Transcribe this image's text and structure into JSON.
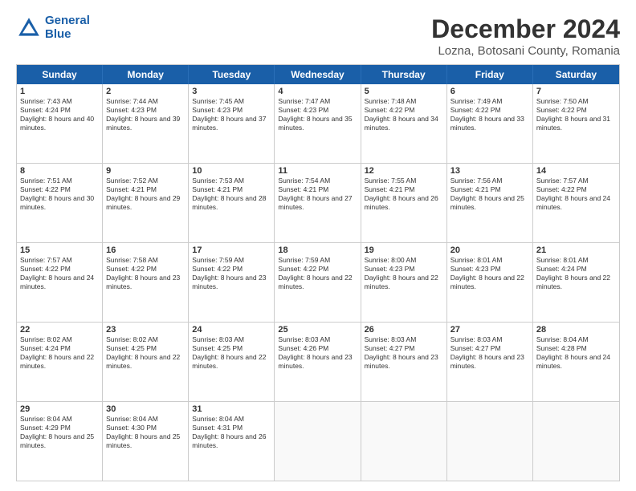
{
  "logo": {
    "line1": "General",
    "line2": "Blue"
  },
  "title": "December 2024",
  "subtitle": "Lozna, Botosani County, Romania",
  "header_days": [
    "Sunday",
    "Monday",
    "Tuesday",
    "Wednesday",
    "Thursday",
    "Friday",
    "Saturday"
  ],
  "weeks": [
    [
      {
        "day": "1",
        "sunrise": "Sunrise: 7:43 AM",
        "sunset": "Sunset: 4:24 PM",
        "daylight": "Daylight: 8 hours and 40 minutes."
      },
      {
        "day": "2",
        "sunrise": "Sunrise: 7:44 AM",
        "sunset": "Sunset: 4:23 PM",
        "daylight": "Daylight: 8 hours and 39 minutes."
      },
      {
        "day": "3",
        "sunrise": "Sunrise: 7:45 AM",
        "sunset": "Sunset: 4:23 PM",
        "daylight": "Daylight: 8 hours and 37 minutes."
      },
      {
        "day": "4",
        "sunrise": "Sunrise: 7:47 AM",
        "sunset": "Sunset: 4:23 PM",
        "daylight": "Daylight: 8 hours and 35 minutes."
      },
      {
        "day": "5",
        "sunrise": "Sunrise: 7:48 AM",
        "sunset": "Sunset: 4:22 PM",
        "daylight": "Daylight: 8 hours and 34 minutes."
      },
      {
        "day": "6",
        "sunrise": "Sunrise: 7:49 AM",
        "sunset": "Sunset: 4:22 PM",
        "daylight": "Daylight: 8 hours and 33 minutes."
      },
      {
        "day": "7",
        "sunrise": "Sunrise: 7:50 AM",
        "sunset": "Sunset: 4:22 PM",
        "daylight": "Daylight: 8 hours and 31 minutes."
      }
    ],
    [
      {
        "day": "8",
        "sunrise": "Sunrise: 7:51 AM",
        "sunset": "Sunset: 4:22 PM",
        "daylight": "Daylight: 8 hours and 30 minutes."
      },
      {
        "day": "9",
        "sunrise": "Sunrise: 7:52 AM",
        "sunset": "Sunset: 4:21 PM",
        "daylight": "Daylight: 8 hours and 29 minutes."
      },
      {
        "day": "10",
        "sunrise": "Sunrise: 7:53 AM",
        "sunset": "Sunset: 4:21 PM",
        "daylight": "Daylight: 8 hours and 28 minutes."
      },
      {
        "day": "11",
        "sunrise": "Sunrise: 7:54 AM",
        "sunset": "Sunset: 4:21 PM",
        "daylight": "Daylight: 8 hours and 27 minutes."
      },
      {
        "day": "12",
        "sunrise": "Sunrise: 7:55 AM",
        "sunset": "Sunset: 4:21 PM",
        "daylight": "Daylight: 8 hours and 26 minutes."
      },
      {
        "day": "13",
        "sunrise": "Sunrise: 7:56 AM",
        "sunset": "Sunset: 4:21 PM",
        "daylight": "Daylight: 8 hours and 25 minutes."
      },
      {
        "day": "14",
        "sunrise": "Sunrise: 7:57 AM",
        "sunset": "Sunset: 4:22 PM",
        "daylight": "Daylight: 8 hours and 24 minutes."
      }
    ],
    [
      {
        "day": "15",
        "sunrise": "Sunrise: 7:57 AM",
        "sunset": "Sunset: 4:22 PM",
        "daylight": "Daylight: 8 hours and 24 minutes."
      },
      {
        "day": "16",
        "sunrise": "Sunrise: 7:58 AM",
        "sunset": "Sunset: 4:22 PM",
        "daylight": "Daylight: 8 hours and 23 minutes."
      },
      {
        "day": "17",
        "sunrise": "Sunrise: 7:59 AM",
        "sunset": "Sunset: 4:22 PM",
        "daylight": "Daylight: 8 hours and 23 minutes."
      },
      {
        "day": "18",
        "sunrise": "Sunrise: 7:59 AM",
        "sunset": "Sunset: 4:22 PM",
        "daylight": "Daylight: 8 hours and 22 minutes."
      },
      {
        "day": "19",
        "sunrise": "Sunrise: 8:00 AM",
        "sunset": "Sunset: 4:23 PM",
        "daylight": "Daylight: 8 hours and 22 minutes."
      },
      {
        "day": "20",
        "sunrise": "Sunrise: 8:01 AM",
        "sunset": "Sunset: 4:23 PM",
        "daylight": "Daylight: 8 hours and 22 minutes."
      },
      {
        "day": "21",
        "sunrise": "Sunrise: 8:01 AM",
        "sunset": "Sunset: 4:24 PM",
        "daylight": "Daylight: 8 hours and 22 minutes."
      }
    ],
    [
      {
        "day": "22",
        "sunrise": "Sunrise: 8:02 AM",
        "sunset": "Sunset: 4:24 PM",
        "daylight": "Daylight: 8 hours and 22 minutes."
      },
      {
        "day": "23",
        "sunrise": "Sunrise: 8:02 AM",
        "sunset": "Sunset: 4:25 PM",
        "daylight": "Daylight: 8 hours and 22 minutes."
      },
      {
        "day": "24",
        "sunrise": "Sunrise: 8:03 AM",
        "sunset": "Sunset: 4:25 PM",
        "daylight": "Daylight: 8 hours and 22 minutes."
      },
      {
        "day": "25",
        "sunrise": "Sunrise: 8:03 AM",
        "sunset": "Sunset: 4:26 PM",
        "daylight": "Daylight: 8 hours and 23 minutes."
      },
      {
        "day": "26",
        "sunrise": "Sunrise: 8:03 AM",
        "sunset": "Sunset: 4:27 PM",
        "daylight": "Daylight: 8 hours and 23 minutes."
      },
      {
        "day": "27",
        "sunrise": "Sunrise: 8:03 AM",
        "sunset": "Sunset: 4:27 PM",
        "daylight": "Daylight: 8 hours and 23 minutes."
      },
      {
        "day": "28",
        "sunrise": "Sunrise: 8:04 AM",
        "sunset": "Sunset: 4:28 PM",
        "daylight": "Daylight: 8 hours and 24 minutes."
      }
    ],
    [
      {
        "day": "29",
        "sunrise": "Sunrise: 8:04 AM",
        "sunset": "Sunset: 4:29 PM",
        "daylight": "Daylight: 8 hours and 25 minutes."
      },
      {
        "day": "30",
        "sunrise": "Sunrise: 8:04 AM",
        "sunset": "Sunset: 4:30 PM",
        "daylight": "Daylight: 8 hours and 25 minutes."
      },
      {
        "day": "31",
        "sunrise": "Sunrise: 8:04 AM",
        "sunset": "Sunset: 4:31 PM",
        "daylight": "Daylight: 8 hours and 26 minutes."
      },
      null,
      null,
      null,
      null
    ]
  ]
}
